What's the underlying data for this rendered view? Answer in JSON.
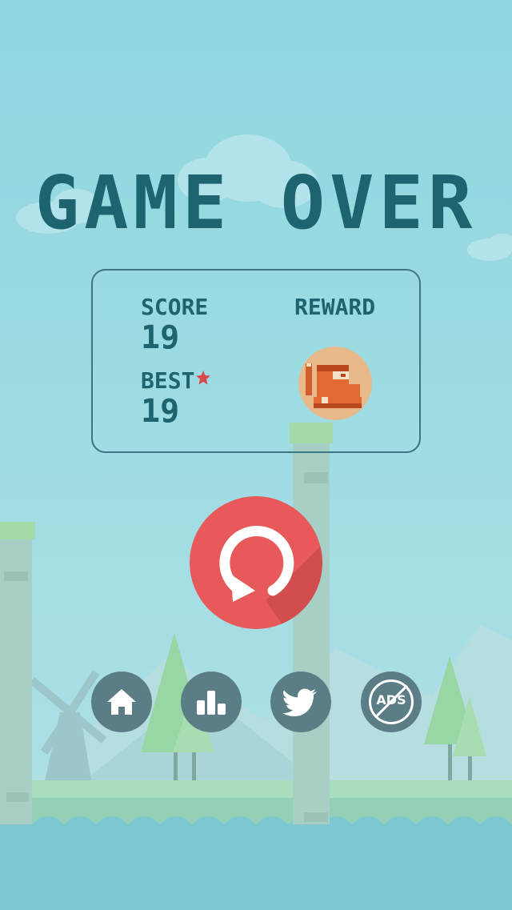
{
  "screen": {
    "title": "GAME OVER"
  },
  "stats": {
    "score_label": "SCORE",
    "score_value": "19",
    "best_label": "BEST",
    "best_value": "19",
    "reward_label": "REWARD"
  },
  "buttons": {
    "replay": "replay-icon",
    "home": "home-icon",
    "leaderboard": "leaderboard-icon",
    "twitter": "twitter-icon",
    "no_ads_text": "ADS"
  },
  "colors": {
    "title": "#1e6370",
    "replay_button": "#e85a5a",
    "round_button": "#5b7d86",
    "sky": "#9adbe2",
    "water": "#7cc8d2",
    "star": "#d94848",
    "reward_circle": "#e8b98a"
  }
}
